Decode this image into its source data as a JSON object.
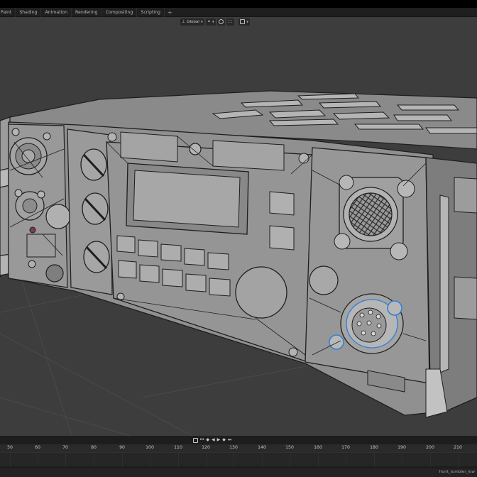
{
  "workspace_tabs": [
    "Paint",
    "Shading",
    "Animation",
    "Rendering",
    "Compositing",
    "Scripting"
  ],
  "workspace_add": "+",
  "header": {
    "transform_orientation": "Global"
  },
  "timeline": {
    "frame_labels": [
      "50",
      "60",
      "70",
      "80",
      "90",
      "100",
      "110",
      "120",
      "130",
      "140",
      "150",
      "160",
      "170",
      "180",
      "190",
      "200",
      "210"
    ]
  },
  "status": {
    "object_name": "front_tumbler_low"
  },
  "colors": {
    "viewport_bg": "#3d3d3d",
    "mesh_fill": "#8e8e8e",
    "wire": "#1e1e1e",
    "selection_blue": "#2f7fd6"
  }
}
